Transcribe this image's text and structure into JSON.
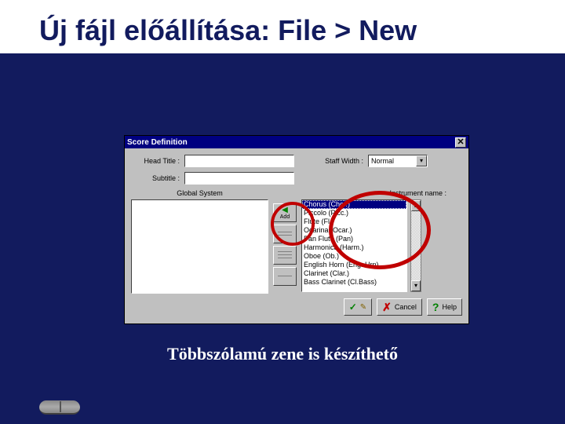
{
  "slide": {
    "title": "Új fájl előállítása: File > New",
    "caption": "Többszólamú zene is készíthető"
  },
  "dialog": {
    "title": "Score Definition",
    "labels": {
      "head_title": "Head Title :",
      "subtitle": "Subtitle :",
      "staff_width": "Staff Width :",
      "global_system": "Global System",
      "instrument_name": "Instrument name :"
    },
    "staff_width_value": "Normal",
    "tools": {
      "add": "Add"
    },
    "instruments": [
      "Chorus (Chor.)",
      "Piccolo (Picc.)",
      "Flute (Fl.)",
      "Ocarina (Ocar.)",
      "Pan Flute (Pan)",
      "Harmonica (Harm.)",
      "Oboe (Ob.)",
      "English Horn (Eng. Hrn)",
      "Clarinet (Clar.)",
      "Bass Clarinet (Cl.Bass)"
    ],
    "selected_instrument_index": 0,
    "buttons": {
      "cancel": "Cancel",
      "help": "Help"
    }
  }
}
